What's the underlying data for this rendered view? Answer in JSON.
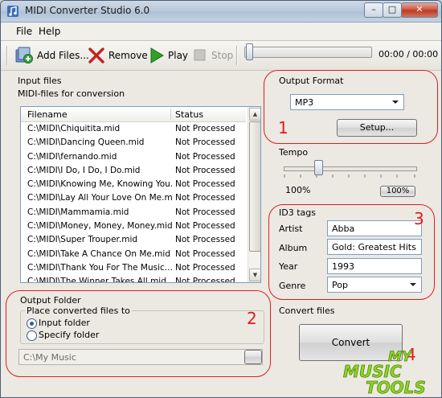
{
  "window": {
    "title": "MIDI Converter Studio 6.0",
    "controls": {
      "minimize": "–",
      "maximize": "□",
      "close": "✕"
    }
  },
  "menu": {
    "file": "File",
    "help": "Help"
  },
  "toolbar": {
    "add_files": "Add Files...",
    "remove": "Remove",
    "play": "Play",
    "stop": "Stop",
    "time": "00:00 / 00:00",
    "seek_position": 0
  },
  "input_files": {
    "heading": "Input files",
    "subheading": "MIDI-files for conversion",
    "columns": {
      "filename": "Filename",
      "status": "Status"
    },
    "rows": [
      {
        "filename": "C:\\MIDI\\Chiquitita.mid",
        "status": "Not Processed"
      },
      {
        "filename": "C:\\MIDI\\Dancing Queen.mid",
        "status": "Not Processed"
      },
      {
        "filename": "C:\\MIDI\\fernando.mid",
        "status": "Not Processed"
      },
      {
        "filename": "C:\\MIDI\\I Do, I Do, I Do.mid",
        "status": "Not Processed"
      },
      {
        "filename": "C:\\MIDI\\Knowing Me, Knowing You...",
        "status": "Not Processed"
      },
      {
        "filename": "C:\\MIDI\\Lay All Your Love On Me.mid",
        "status": "Not Processed"
      },
      {
        "filename": "C:\\MIDI\\Mammamia.mid",
        "status": "Not Processed"
      },
      {
        "filename": "C:\\MIDI\\Money, Money, Money.mid",
        "status": "Not Processed"
      },
      {
        "filename": "C:\\MIDI\\Super Trouper.mid",
        "status": "Not Processed"
      },
      {
        "filename": "C:\\MIDI\\Take A Chance On Me.mid",
        "status": "Not Processed"
      },
      {
        "filename": "C:\\MIDI\\Thank You For The Music....",
        "status": "Not Processed"
      },
      {
        "filename": "C:\\MIDI\\The Winner Takes All.mid",
        "status": "Not Processed"
      }
    ]
  },
  "output_format": {
    "heading": "Output Format",
    "selected": "MP3",
    "setup_button": "Setup...",
    "annotation": "1"
  },
  "tempo": {
    "heading": "Tempo",
    "value_label": "100%",
    "reset_button": "100%",
    "value_percent": 100
  },
  "id3": {
    "heading": "ID3 tags",
    "annotation": "3",
    "artist_label": "Artist",
    "artist": "Abba",
    "album_label": "Album",
    "album": "Gold: Greatest Hits",
    "year_label": "Year",
    "year": "1993",
    "genre_label": "Genre",
    "genre": "Pop"
  },
  "output_folder": {
    "heading": "Output Folder",
    "group_label": "Place converted files to",
    "option_input": "Input folder",
    "option_specify": "Specify folder",
    "selected_option": "Input folder",
    "path": "C:\\My Music",
    "annotation": "2"
  },
  "convert": {
    "heading": "Convert files",
    "button": "Convert",
    "annotation": "4"
  },
  "watermark": {
    "line1": "MY",
    "line2": "MUSIC",
    "line3": "TOOLS"
  },
  "colors": {
    "annotation_red": "#e21b1b",
    "play_green": "#2fa12b",
    "remove_red": "#c62020",
    "logo_green": "#8fd323"
  }
}
